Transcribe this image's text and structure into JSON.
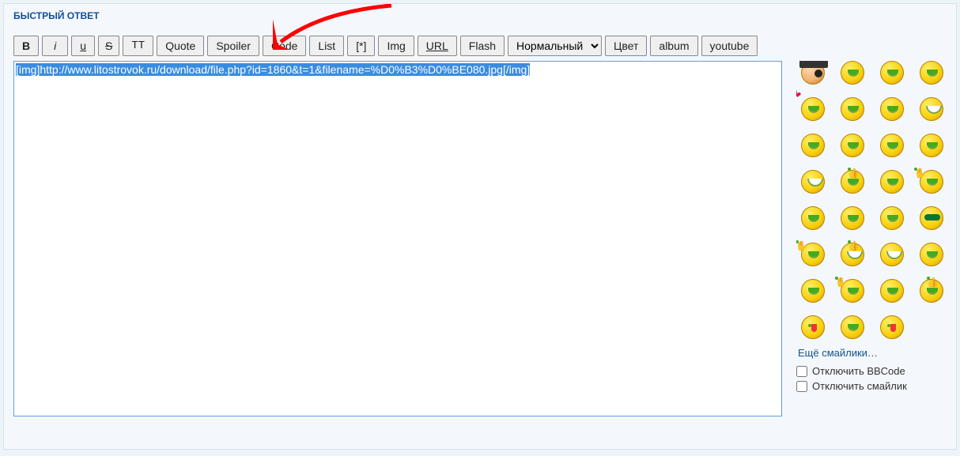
{
  "panel": {
    "title": "БЫСТРЫЙ ОТВЕТ"
  },
  "toolbar": {
    "bold": " B ",
    "italic": "i",
    "underline": "u",
    "strike": "  S  ",
    "tt": "TT",
    "quote": "Quote",
    "spoiler": "Spoiler",
    "code": "Code",
    "list": "List",
    "listitem": "[*]",
    "img": "Img",
    "url": "URL",
    "flash": "Flash",
    "fontselect": "Нормальный",
    "color": "Цвет",
    "album": "album",
    "youtube": "youtube"
  },
  "editor": {
    "content": "[img]http://www.litostrovok.ru/download/file.php?id=1860&t=1&filename=%D0%B3%D0%BE080.jpg[/img]"
  },
  "sidebar": {
    "more_smilies": "Ещё смайлики…",
    "opt_bbcode": "Отключить BBCode",
    "opt_smilies": "Отключить смайлик"
  },
  "colors": {
    "link": "#105289",
    "title": "#115098",
    "arrow": "#ff0000"
  }
}
